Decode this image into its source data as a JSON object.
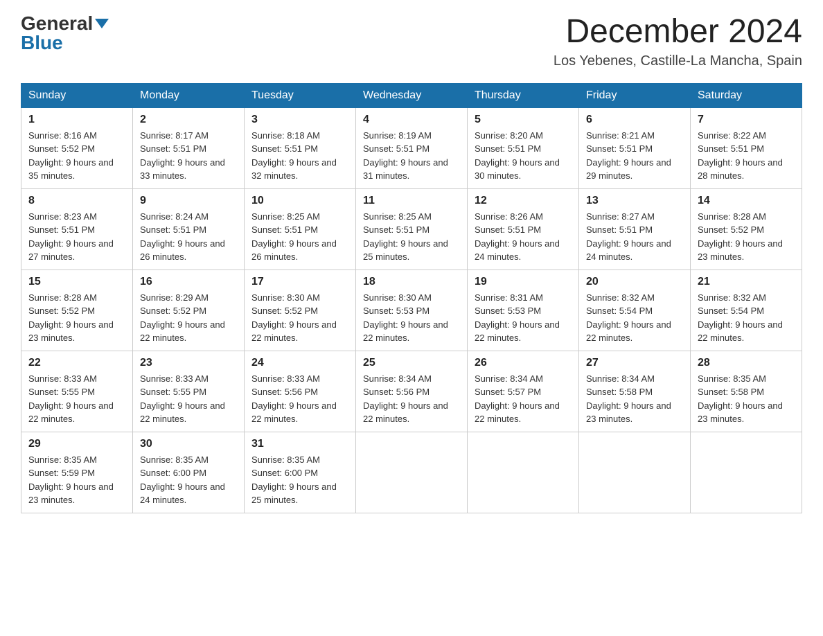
{
  "header": {
    "logo_general": "General",
    "logo_blue": "Blue",
    "month_title": "December 2024",
    "location": "Los Yebenes, Castille-La Mancha, Spain"
  },
  "weekdays": [
    "Sunday",
    "Monday",
    "Tuesday",
    "Wednesday",
    "Thursday",
    "Friday",
    "Saturday"
  ],
  "weeks": [
    [
      {
        "day": "1",
        "sunrise": "8:16 AM",
        "sunset": "5:52 PM",
        "daylight": "9 hours and 35 minutes."
      },
      {
        "day": "2",
        "sunrise": "8:17 AM",
        "sunset": "5:51 PM",
        "daylight": "9 hours and 33 minutes."
      },
      {
        "day": "3",
        "sunrise": "8:18 AM",
        "sunset": "5:51 PM",
        "daylight": "9 hours and 32 minutes."
      },
      {
        "day": "4",
        "sunrise": "8:19 AM",
        "sunset": "5:51 PM",
        "daylight": "9 hours and 31 minutes."
      },
      {
        "day": "5",
        "sunrise": "8:20 AM",
        "sunset": "5:51 PM",
        "daylight": "9 hours and 30 minutes."
      },
      {
        "day": "6",
        "sunrise": "8:21 AM",
        "sunset": "5:51 PM",
        "daylight": "9 hours and 29 minutes."
      },
      {
        "day": "7",
        "sunrise": "8:22 AM",
        "sunset": "5:51 PM",
        "daylight": "9 hours and 28 minutes."
      }
    ],
    [
      {
        "day": "8",
        "sunrise": "8:23 AM",
        "sunset": "5:51 PM",
        "daylight": "9 hours and 27 minutes."
      },
      {
        "day": "9",
        "sunrise": "8:24 AM",
        "sunset": "5:51 PM",
        "daylight": "9 hours and 26 minutes."
      },
      {
        "day": "10",
        "sunrise": "8:25 AM",
        "sunset": "5:51 PM",
        "daylight": "9 hours and 26 minutes."
      },
      {
        "day": "11",
        "sunrise": "8:25 AM",
        "sunset": "5:51 PM",
        "daylight": "9 hours and 25 minutes."
      },
      {
        "day": "12",
        "sunrise": "8:26 AM",
        "sunset": "5:51 PM",
        "daylight": "9 hours and 24 minutes."
      },
      {
        "day": "13",
        "sunrise": "8:27 AM",
        "sunset": "5:51 PM",
        "daylight": "9 hours and 24 minutes."
      },
      {
        "day": "14",
        "sunrise": "8:28 AM",
        "sunset": "5:52 PM",
        "daylight": "9 hours and 23 minutes."
      }
    ],
    [
      {
        "day": "15",
        "sunrise": "8:28 AM",
        "sunset": "5:52 PM",
        "daylight": "9 hours and 23 minutes."
      },
      {
        "day": "16",
        "sunrise": "8:29 AM",
        "sunset": "5:52 PM",
        "daylight": "9 hours and 22 minutes."
      },
      {
        "day": "17",
        "sunrise": "8:30 AM",
        "sunset": "5:52 PM",
        "daylight": "9 hours and 22 minutes."
      },
      {
        "day": "18",
        "sunrise": "8:30 AM",
        "sunset": "5:53 PM",
        "daylight": "9 hours and 22 minutes."
      },
      {
        "day": "19",
        "sunrise": "8:31 AM",
        "sunset": "5:53 PM",
        "daylight": "9 hours and 22 minutes."
      },
      {
        "day": "20",
        "sunrise": "8:32 AM",
        "sunset": "5:54 PM",
        "daylight": "9 hours and 22 minutes."
      },
      {
        "day": "21",
        "sunrise": "8:32 AM",
        "sunset": "5:54 PM",
        "daylight": "9 hours and 22 minutes."
      }
    ],
    [
      {
        "day": "22",
        "sunrise": "8:33 AM",
        "sunset": "5:55 PM",
        "daylight": "9 hours and 22 minutes."
      },
      {
        "day": "23",
        "sunrise": "8:33 AM",
        "sunset": "5:55 PM",
        "daylight": "9 hours and 22 minutes."
      },
      {
        "day": "24",
        "sunrise": "8:33 AM",
        "sunset": "5:56 PM",
        "daylight": "9 hours and 22 minutes."
      },
      {
        "day": "25",
        "sunrise": "8:34 AM",
        "sunset": "5:56 PM",
        "daylight": "9 hours and 22 minutes."
      },
      {
        "day": "26",
        "sunrise": "8:34 AM",
        "sunset": "5:57 PM",
        "daylight": "9 hours and 22 minutes."
      },
      {
        "day": "27",
        "sunrise": "8:34 AM",
        "sunset": "5:58 PM",
        "daylight": "9 hours and 23 minutes."
      },
      {
        "day": "28",
        "sunrise": "8:35 AM",
        "sunset": "5:58 PM",
        "daylight": "9 hours and 23 minutes."
      }
    ],
    [
      {
        "day": "29",
        "sunrise": "8:35 AM",
        "sunset": "5:59 PM",
        "daylight": "9 hours and 23 minutes."
      },
      {
        "day": "30",
        "sunrise": "8:35 AM",
        "sunset": "6:00 PM",
        "daylight": "9 hours and 24 minutes."
      },
      {
        "day": "31",
        "sunrise": "8:35 AM",
        "sunset": "6:00 PM",
        "daylight": "9 hours and 25 minutes."
      },
      null,
      null,
      null,
      null
    ]
  ]
}
